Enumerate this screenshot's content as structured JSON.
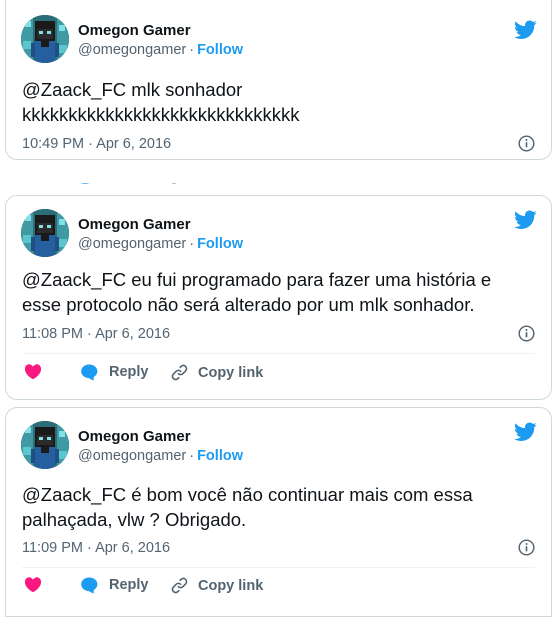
{
  "colors": {
    "accent": "#1d9bf0",
    "text": "#0f1419",
    "muted": "#536471",
    "like": "#f91880",
    "border": "#cfd9de"
  },
  "icons": {
    "brand": "twitter-bird-icon",
    "info": "info-icon",
    "like": "heart-icon",
    "reply": "reply-bubble-icon",
    "copy": "link-icon"
  },
  "tweets": [
    {
      "author": {
        "name": "Omegon Gamer",
        "handle": "@omegongamer",
        "follow": "Follow"
      },
      "text_lines": [
        "@Zaack_FC mlk sonhador",
        "kkkkkkkkkkkkkkkkkkkkkkkkkkkkkk"
      ],
      "time": "10:49 PM · Apr 6, 2016"
    },
    {
      "author": {
        "name": "Omegon Gamer",
        "handle": "@omegongamer",
        "follow": "Follow"
      },
      "text_lines": [
        "@Zaack_FC eu fui programado para fazer uma história e",
        "esse protocolo não será alterado por um mlk sonhador."
      ],
      "time": "11:08 PM · Apr 6, 2016",
      "actions": {
        "reply": "Reply",
        "copy": "Copy link"
      }
    },
    {
      "author": {
        "name": "Omegon Gamer",
        "handle": "@omegongamer",
        "follow": "Follow"
      },
      "text_lines": [
        "@Zaack_FC é bom você não continuar mais com essa",
        "palhaçada, vlw ? Obrigado."
      ],
      "time": "11:09 PM · Apr 6, 2016",
      "actions": {
        "reply": "Reply",
        "copy": "Copy link"
      }
    }
  ]
}
